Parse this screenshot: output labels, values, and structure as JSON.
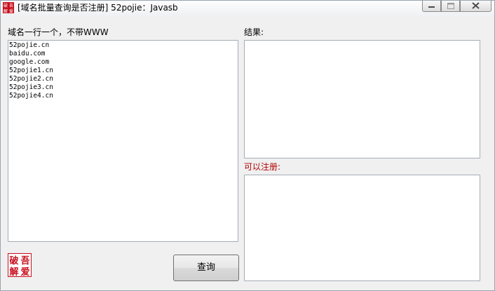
{
  "window": {
    "title": "[域名批量查询是否注册] 52pojie：Javasb",
    "seal_text": [
      "破",
      "吾",
      "解",
      "爱"
    ]
  },
  "input_label": "域名一行一个，不带WWW",
  "domains": [
    "52pojie.cn",
    "baidu.com",
    "google.com",
    "52pojie1.cn",
    "52pojie2.cn",
    "52pojie3.cn",
    "52pojie4.cn"
  ],
  "result_label": "结果:",
  "result_text": "",
  "available_label": "可以注册:",
  "available_text": "",
  "query_button": "查询",
  "colors": {
    "accent_red": "#b30000",
    "seal_red": "#c8101e"
  },
  "icons": [
    "app-icon",
    "minimize-icon",
    "maximize-icon",
    "close-icon",
    "seal-logo-icon"
  ]
}
